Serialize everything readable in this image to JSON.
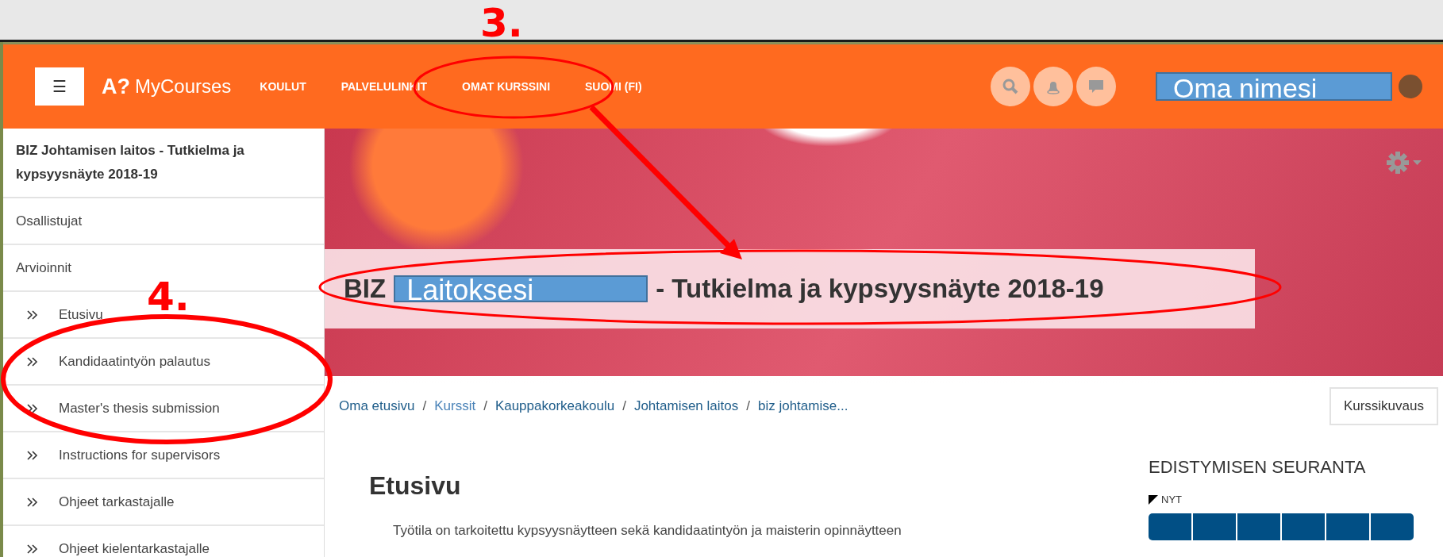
{
  "navbar": {
    "menu_button": "☰",
    "logo": {
      "mark": "A?",
      "name": "MyCourses"
    },
    "items": [
      "KOULUT",
      "PALVELULINKIT",
      "OMAT KURSSINI",
      "SUOMI (FI)"
    ],
    "user_name": "Oma nimesi"
  },
  "sidebar": {
    "title": "BIZ Johtamisen laitos - Tutkielma ja kypsyysnäyte 2018-19",
    "items": [
      {
        "label": "Osallistujat",
        "kind": "link"
      },
      {
        "label": "Arvioinnit",
        "kind": "link"
      },
      {
        "label": "Etusivu",
        "kind": "section"
      },
      {
        "label": "Kandidaatintyön palautus",
        "kind": "section"
      },
      {
        "label": "Master's thesis submission",
        "kind": "section"
      },
      {
        "label": "Instructions for supervisors",
        "kind": "section"
      },
      {
        "label": "Ohjeet tarkastajalle",
        "kind": "section"
      },
      {
        "label": "Ohjeet kielentarkastajalle",
        "kind": "section"
      }
    ]
  },
  "header": {
    "title_start": "BIZ",
    "title_cover": "Laitoksesi",
    "title_end": "- Tutkielma ja kypsyysnäyte 2018-19"
  },
  "breadcrumbs": [
    {
      "label": "Oma etusivu",
      "visited": false
    },
    {
      "separator_before": "/",
      "label": "Kurssit",
      "visited": true
    },
    {
      "separator_before": "/",
      "label": "Kauppakorkeakoulu",
      "visited": false
    },
    {
      "separator_before": "/",
      "label": "Johtamisen laitos",
      "visited": false
    },
    {
      "separator_before": "/",
      "label": "biz johtamise...",
      "visited": false
    }
  ],
  "course_button": "Kurssikuvaus",
  "content": {
    "heading": "Etusivu",
    "text": "Työtila on tarkoitettu kypsyysnäytteen sekä kandidaatintyön ja maisterin opinnäytteen"
  },
  "progress": {
    "heading": "EDISTYMISEN SEURANTA",
    "now_label": "NYT",
    "segments": [
      {
        "completed": false
      },
      {
        "completed": false
      },
      {
        "completed": false
      },
      {
        "completed": false
      },
      {
        "completed": false
      },
      {
        "completed": false
      }
    ]
  },
  "annotations": [
    {
      "label": "3."
    },
    {
      "label": "4."
    }
  ]
}
